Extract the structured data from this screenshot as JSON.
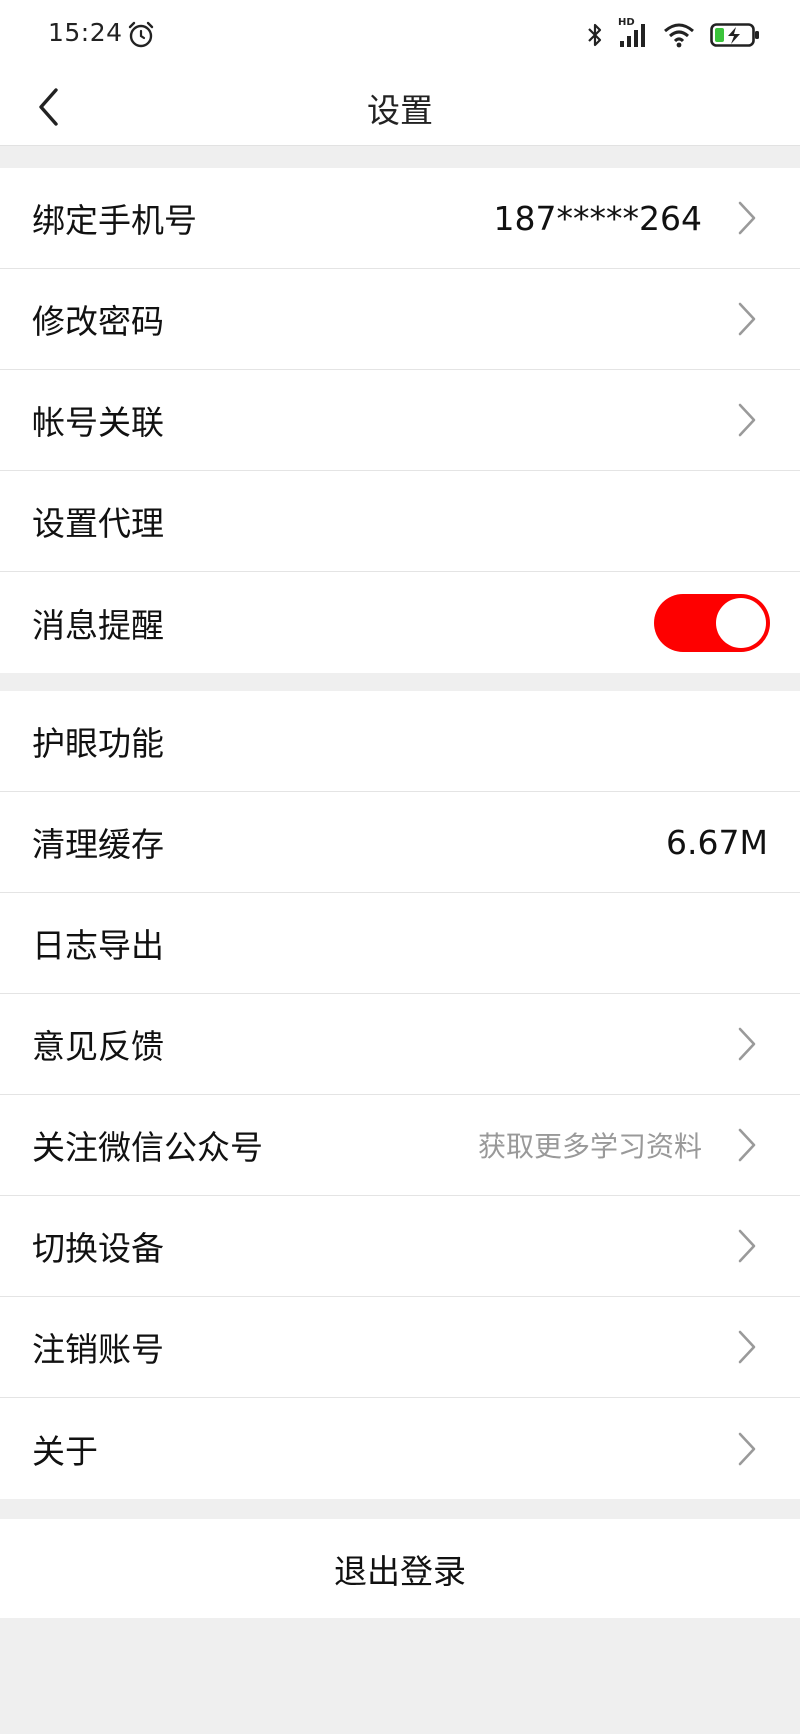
{
  "status": {
    "time": "15:24",
    "alarm_icon": "alarm-clock-icon",
    "bluetooth_icon": "bluetooth-icon",
    "signal_label": "HD",
    "signal_icon": "cellular-signal-icon",
    "wifi_icon": "wifi-icon",
    "battery_icon": "battery-charging-icon"
  },
  "nav": {
    "title": "设置",
    "back_icon": "chevron-left-icon"
  },
  "colors": {
    "accent": "#fe0000",
    "background": "#efefef",
    "secondary_text": "#999999"
  },
  "account_group": [
    {
      "label": "绑定手机号",
      "value": "187*****264",
      "arrow": true
    },
    {
      "label": "修改密码",
      "arrow": true
    },
    {
      "label": "帐号关联",
      "arrow": true
    },
    {
      "label": "设置代理",
      "arrow": false
    },
    {
      "label": "消息提醒",
      "toggle": true,
      "toggle_on": true
    }
  ],
  "general_group": [
    {
      "label": "护眼功能",
      "arrow": false
    },
    {
      "label": "清理缓存",
      "value": "6.67M",
      "arrow": false
    },
    {
      "label": "日志导出",
      "arrow": false
    },
    {
      "label": "意见反馈",
      "arrow": true
    },
    {
      "label": "关注微信公众号",
      "value": "获取更多学习资料",
      "arrow": true
    },
    {
      "label": "切换设备",
      "arrow": true
    },
    {
      "label": "注销账号",
      "arrow": true
    },
    {
      "label": "关于",
      "arrow": true
    }
  ],
  "logout": {
    "label": "退出登录"
  }
}
